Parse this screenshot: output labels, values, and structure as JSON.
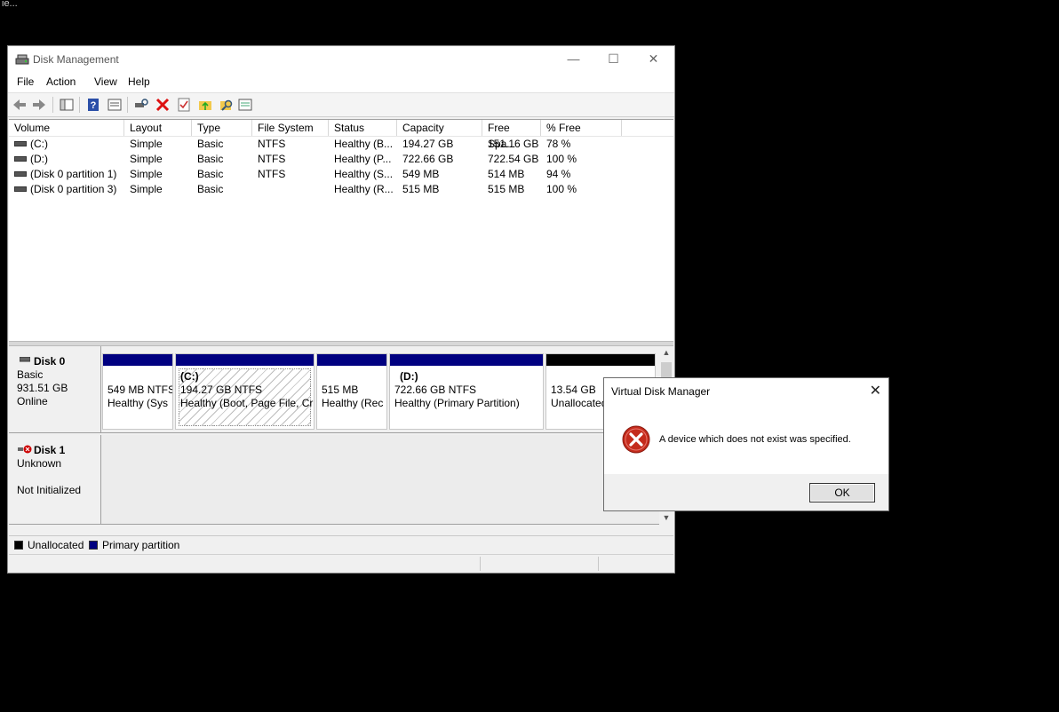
{
  "desktop": {
    "fragments": [
      "ie..."
    ]
  },
  "window": {
    "title": "Disk Management",
    "controls": {
      "minimize": "—",
      "maximize": "☐",
      "close": "✕"
    }
  },
  "menu": [
    "File",
    "Action",
    "View",
    "Help"
  ],
  "toolbar_icons": [
    "back-icon",
    "forward-icon",
    "console-tree-icon",
    "help-icon",
    "properties-icon",
    "connect-icon",
    "delete-icon",
    "check-icon",
    "folder-up-icon",
    "search-icon",
    "list-icon"
  ],
  "volumes": {
    "headers": [
      "Volume",
      "Layout",
      "Type",
      "File System",
      "Status",
      "Capacity",
      "Free Spa...",
      "% Free"
    ],
    "rows": [
      [
        "(C:)",
        "Simple",
        "Basic",
        "NTFS",
        "Healthy (B...",
        "194.27 GB",
        "151.16 GB",
        "78 %"
      ],
      [
        "(D:)",
        "Simple",
        "Basic",
        "NTFS",
        "Healthy (P...",
        "722.66 GB",
        "722.54 GB",
        "100 %"
      ],
      [
        "(Disk 0 partition 1)",
        "Simple",
        "Basic",
        "NTFS",
        "Healthy (S...",
        "549 MB",
        "514 MB",
        "94 %"
      ],
      [
        "(Disk 0 partition 3)",
        "Simple",
        "Basic",
        "",
        "Healthy (R...",
        "515 MB",
        "515 MB",
        "100 %"
      ]
    ]
  },
  "disks": [
    {
      "name": "Disk 0",
      "type": "Basic",
      "size": "931.51 GB",
      "state": "Online",
      "partitions": [
        {
          "title": "",
          "line1": "549 MB NTFS",
          "line2": "Healthy (Sys",
          "bar": "#000080"
        },
        {
          "title": "(C:)",
          "line1": "194.27 GB NTFS",
          "line2": "Healthy (Boot, Page File, Cr",
          "bar": "#000080"
        },
        {
          "title": "",
          "line1": "515 MB",
          "line2": "Healthy (Rec",
          "bar": "#000080"
        },
        {
          "title": "(D:)",
          "line1": "722.66 GB NTFS",
          "line2": "Healthy (Primary Partition)",
          "bar": "#000080"
        },
        {
          "title": "",
          "line1": "13.54 GB",
          "line2": "Unallocated",
          "bar": "#000000"
        }
      ]
    },
    {
      "name": "Disk 1",
      "type": "Unknown",
      "size": "",
      "state": "Not Initialized"
    }
  ],
  "legend": [
    {
      "label": "Unallocated",
      "color": "#000000"
    },
    {
      "label": "Primary partition",
      "color": "#000080"
    }
  ],
  "dialog": {
    "title": "Virtual Disk Manager",
    "message": "A device which does not exist was specified.",
    "ok": "OK",
    "close": "✕"
  }
}
